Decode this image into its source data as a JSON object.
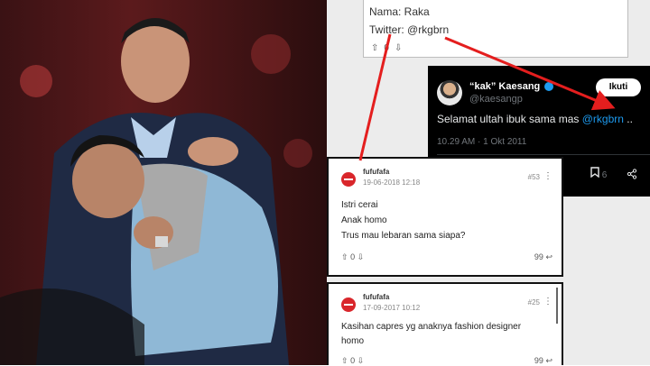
{
  "top_card": {
    "name_line": "Nama: Raka",
    "twitter_line": "Twitter: @rkgbrn",
    "votes": "0"
  },
  "tweet": {
    "display_name": "“kak” Kaesang",
    "handle": "@kaesangp",
    "follow_label": "Ikuti",
    "text_before": "Selamat ultah ibuk sama mas ",
    "mention": "@rkgbrn",
    "text_after": " ..",
    "time": "10.29 AM · 1 Okt 2011",
    "bookmark_count": "6"
  },
  "comments": [
    {
      "username": "fufufafa",
      "date": "19-06-2018 12:18",
      "number": "#53",
      "lines": [
        "Istri cerai",
        "Anak homo",
        "Trus mau lebaran sama siapa?"
      ],
      "votes": "0",
      "reply_count": "99"
    },
    {
      "username": "fufufafa",
      "date": "17-09-2017 10:12",
      "number": "#25",
      "lines": [
        "Kasihan capres yg anaknya fashion designer",
        "homo"
      ],
      "votes": "0",
      "reply_count": "99"
    }
  ],
  "colors": {
    "annotation_red": "#e41e1e",
    "twitter_blue": "#1d9bf0",
    "tweet_bg": "#000000"
  },
  "icons": [
    "verified-icon",
    "bookmark-icon",
    "share-icon",
    "upvote-icon",
    "downvote-icon",
    "reply-icon",
    "more-icon"
  ]
}
